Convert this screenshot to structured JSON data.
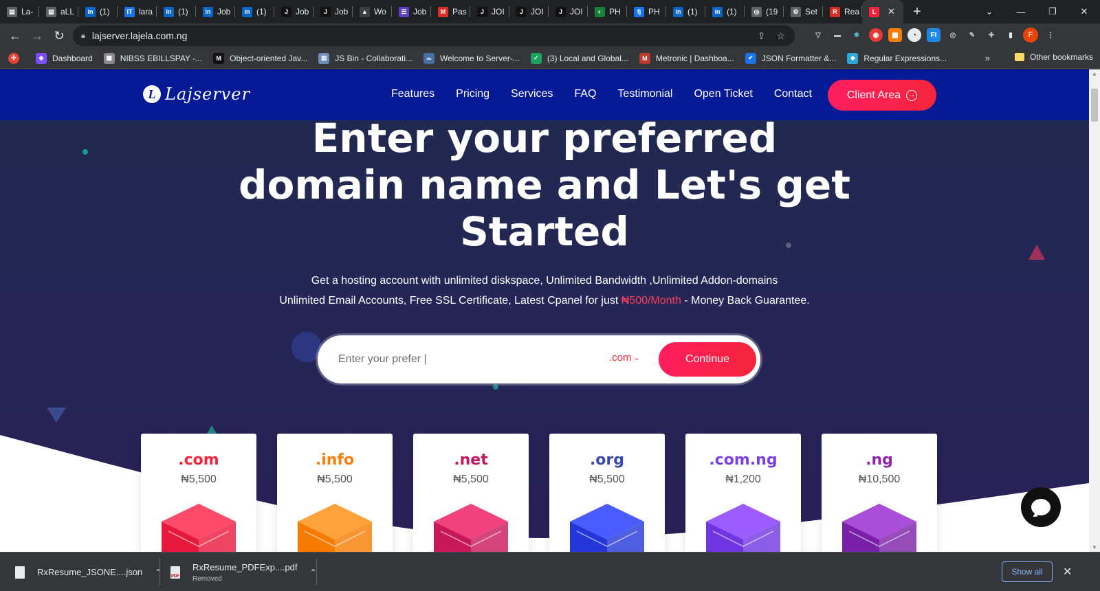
{
  "browser": {
    "tabs": [
      {
        "label": "La-",
        "color": "#5f6368",
        "glyph": "▤"
      },
      {
        "label": "aLL",
        "color": "#5f6368",
        "glyph": "▤"
      },
      {
        "label": "(1)",
        "color": "#0a66c2",
        "glyph": "in"
      },
      {
        "label": "lara",
        "color": "#1a73e8",
        "glyph": "IT"
      },
      {
        "label": "(1)",
        "color": "#0a66c2",
        "glyph": "in"
      },
      {
        "label": "Job",
        "color": "#0a66c2",
        "glyph": "in"
      },
      {
        "label": "(1)",
        "color": "#0a66c2",
        "glyph": "in"
      },
      {
        "label": "Job",
        "color": "#111111",
        "glyph": "J"
      },
      {
        "label": "Job",
        "color": "#111111",
        "glyph": "J"
      },
      {
        "label": "Wo",
        "color": "#3c4043",
        "glyph": "▲"
      },
      {
        "label": "Job",
        "color": "#5b3fc4",
        "glyph": "☰"
      },
      {
        "label": "Pas",
        "color": "#d93025",
        "glyph": "M"
      },
      {
        "label": "JOI",
        "color": "#111111",
        "glyph": "J"
      },
      {
        "label": "JOI",
        "color": "#111111",
        "glyph": "J"
      },
      {
        "label": "JOI",
        "color": "#111111",
        "glyph": "J"
      },
      {
        "label": "PH",
        "color": "#188038",
        "glyph": "◐"
      },
      {
        "label": "PH",
        "color": "#1a73e8",
        "glyph": "fj"
      },
      {
        "label": "(1)",
        "color": "#0a66c2",
        "glyph": "in"
      },
      {
        "label": "(1)",
        "color": "#0a66c2",
        "glyph": "in"
      },
      {
        "label": "(19",
        "color": "#5f6368",
        "glyph": "◎"
      },
      {
        "label": "Set",
        "color": "#5f6368",
        "glyph": "⚙"
      },
      {
        "label": "Rea",
        "color": "#d93025",
        "glyph": "R"
      },
      {
        "label": "",
        "color": "#f5243a",
        "glyph": "L",
        "active": true
      }
    ],
    "new_tab": "+",
    "tab_close": "✕",
    "window_controls": [
      "⌄",
      "—",
      "❐",
      "✕"
    ],
    "url": "lajserver.lajela.com.ng",
    "bookmarks": [
      {
        "label": "Dashboard",
        "color": "#7c4dff",
        "glyph": "◈"
      },
      {
        "label": "NIBSS EBILLSPAY -...",
        "color": "#8a8a8a",
        "glyph": "▦"
      },
      {
        "label": "Object-oriented Jav...",
        "color": "#111111",
        "glyph": "M"
      },
      {
        "label": "JS Bin - Collaborati...",
        "color": "#6c8ebf",
        "glyph": "▥"
      },
      {
        "label": "Welcome to Server-...",
        "color": "#4a6fa5",
        "glyph": "∞"
      },
      {
        "label": "(3) Local and Global...",
        "color": "#1aa260",
        "glyph": "✓"
      },
      {
        "label": "Metronic | Dashboa...",
        "color": "#c0392b",
        "glyph": "M"
      },
      {
        "label": "JSON Formatter &...",
        "color": "#1a73e8",
        "glyph": "✔"
      },
      {
        "label": "Regular Expressions...",
        "color": "#2aa8d8",
        "glyph": "◆"
      }
    ],
    "bookmarks_more": "»",
    "other_bookmarks": "Other bookmarks",
    "profile_initial": "F"
  },
  "site": {
    "logo": "Lajserver",
    "logo_mark": "L",
    "menu": [
      "Features",
      "Pricing",
      "Services",
      "FAQ",
      "Testimonial",
      "Open Ticket",
      "Contact"
    ],
    "client_area": "Client Area",
    "hero_lines": [
      "Enter your preferred",
      "domain name and Let's get",
      "Started"
    ],
    "sub_line1": "Get a hosting account with unlimited diskspace, Unlimited Bandwidth ,Unlimited Addon-domains",
    "sub_line2_pre": "Unlimited Email Accounts, Free SSL Certificate, Latest Cpanel for just ",
    "sub_line2_price": "₦500/Month",
    "sub_line2_post": " - Money Back Guarantee.",
    "search": {
      "placeholder": "Enter your prefer |",
      "tld": ".com",
      "button": "Continue"
    },
    "domains": [
      {
        "tld": ".com",
        "price": "₦5,500",
        "color": "#f5243a",
        "box_top": "#ff4a6a",
        "box_side": "#e8173c"
      },
      {
        "tld": ".info",
        "price": "₦5,500",
        "color": "#fb7d10",
        "box_top": "#ffa23a",
        "box_side": "#f57c00"
      },
      {
        "tld": ".net",
        "price": "₦5,500",
        "color": "#c2185b",
        "box_top": "#f0437e",
        "box_side": "#c8175a"
      },
      {
        "tld": ".org",
        "price": "₦5,500",
        "color": "#3949ab",
        "box_top": "#4a5cff",
        "box_side": "#2436d8"
      },
      {
        "tld": ".com.ng",
        "price": "₦1,200",
        "color": "#7b3fe4",
        "box_top": "#9b5cff",
        "box_side": "#6f35e0"
      },
      {
        "tld": ".ng",
        "price": "₦10,500",
        "color": "#8e24aa",
        "box_top": "#a84ed8",
        "box_side": "#7a1fa8"
      }
    ]
  },
  "downloads": [
    {
      "name": "RxResume_JSONE....json",
      "status": ""
    },
    {
      "name": "RxResume_PDFExp....pdf",
      "status": "Removed"
    }
  ],
  "show_all": "Show all"
}
